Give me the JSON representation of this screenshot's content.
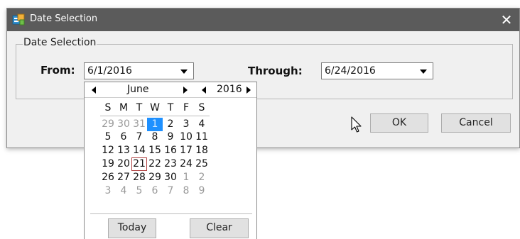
{
  "window": {
    "title": "Date Selection",
    "close_glyph": "✕"
  },
  "group": {
    "legend": "Date Selection"
  },
  "from": {
    "label": "From:",
    "value": "6/1/2016"
  },
  "through": {
    "label": "Through:",
    "value": "6/24/2016"
  },
  "buttons": {
    "ok": "OK",
    "cancel": "Cancel"
  },
  "calendar": {
    "month": "June",
    "year": "2016",
    "weekdays": [
      "S",
      "M",
      "T",
      "W",
      "T",
      "F",
      "S"
    ],
    "weeks": [
      [
        {
          "d": "29",
          "o": 1
        },
        {
          "d": "30",
          "o": 1
        },
        {
          "d": "31",
          "o": 1
        },
        {
          "d": "1",
          "s": 1
        },
        {
          "d": "2"
        },
        {
          "d": "3"
        },
        {
          "d": "4"
        }
      ],
      [
        {
          "d": "5"
        },
        {
          "d": "6"
        },
        {
          "d": "7"
        },
        {
          "d": "8"
        },
        {
          "d": "9"
        },
        {
          "d": "10"
        },
        {
          "d": "11"
        }
      ],
      [
        {
          "d": "12"
        },
        {
          "d": "13"
        },
        {
          "d": "14"
        },
        {
          "d": "15"
        },
        {
          "d": "16"
        },
        {
          "d": "17"
        },
        {
          "d": "18"
        }
      ],
      [
        {
          "d": "19"
        },
        {
          "d": "20"
        },
        {
          "d": "21",
          "t": 1
        },
        {
          "d": "22"
        },
        {
          "d": "23"
        },
        {
          "d": "24"
        },
        {
          "d": "25"
        }
      ],
      [
        {
          "d": "26"
        },
        {
          "d": "27"
        },
        {
          "d": "28"
        },
        {
          "d": "29"
        },
        {
          "d": "30"
        },
        {
          "d": "1",
          "o": 1
        },
        {
          "d": "2",
          "o": 1
        }
      ],
      [
        {
          "d": "3",
          "o": 1
        },
        {
          "d": "4",
          "o": 1
        },
        {
          "d": "5",
          "o": 1
        },
        {
          "d": "6",
          "o": 1
        },
        {
          "d": "7",
          "o": 1
        },
        {
          "d": "8",
          "o": 1
        },
        {
          "d": "9",
          "o": 1
        }
      ]
    ],
    "today_button": "Today",
    "clear_button": "Clear"
  },
  "icons": {
    "app": "app-icon",
    "close": "close-icon",
    "combo": "chevron-down-icon",
    "prev": "triangle-left-icon",
    "next": "triangle-right-icon",
    "cursor": "mouse-pointer-icon"
  },
  "colors": {
    "titlebar": "#5b5b5b",
    "selected_day": "#1e90ff",
    "today_outline": "#b04040"
  }
}
